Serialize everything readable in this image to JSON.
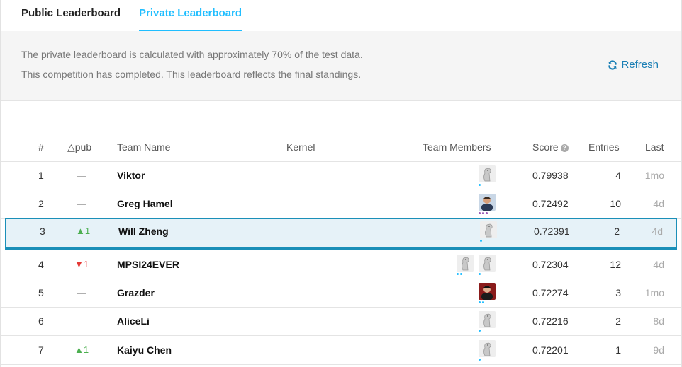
{
  "tabs": [
    {
      "label": "Public Leaderboard"
    },
    {
      "label": "Private Leaderboard"
    }
  ],
  "info": {
    "line1": "The private leaderboard is calculated with approximately 70% of the test data.",
    "line2": "This competition has completed. This leaderboard reflects the final standings.",
    "refresh_label": "Refresh"
  },
  "columns": {
    "rank": "#",
    "delta": "△pub",
    "team": "Team Name",
    "kernel": "Kernel",
    "members": "Team Members",
    "score": "Score",
    "entries": "Entries",
    "last": "Last"
  },
  "rows": [
    {
      "rank": "1",
      "delta": "—",
      "trend": "same",
      "team": "Viktor",
      "members": [
        "default-avatar"
      ],
      "score": "0.79938",
      "entries": "4",
      "last": "1mo"
    },
    {
      "rank": "2",
      "delta": "—",
      "trend": "same",
      "team": "Greg Hamel",
      "members": [
        "photo-avatar"
      ],
      "score": "0.72492",
      "entries": "10",
      "last": "4d"
    },
    {
      "rank": "3",
      "delta": "▲1",
      "trend": "up",
      "team": "Will Zheng",
      "members": [
        "default-avatar"
      ],
      "score": "0.72391",
      "entries": "2",
      "last": "4d"
    },
    {
      "rank": "4",
      "delta": "▼1",
      "trend": "down",
      "team": "MPSI24EVER",
      "members": [
        "default-avatar",
        "default-avatar"
      ],
      "score": "0.72304",
      "entries": "12",
      "last": "4d"
    },
    {
      "rank": "5",
      "delta": "—",
      "trend": "same",
      "team": "Grazder",
      "members": [
        "photo-avatar"
      ],
      "score": "0.72274",
      "entries": "3",
      "last": "1mo"
    },
    {
      "rank": "6",
      "delta": "—",
      "trend": "same",
      "team": "AliceLi",
      "members": [
        "default-avatar"
      ],
      "score": "0.72216",
      "entries": "2",
      "last": "8d"
    },
    {
      "rank": "7",
      "delta": "▲1",
      "trend": "up",
      "team": "Kaiyu Chen",
      "members": [
        "default-avatar"
      ],
      "score": "0.72201",
      "entries": "1",
      "last": "9d"
    }
  ],
  "colors": {
    "accent": "#20beff",
    "highlight_border": "#1a8fb8",
    "up": "#4caf50",
    "down": "#e53935"
  }
}
